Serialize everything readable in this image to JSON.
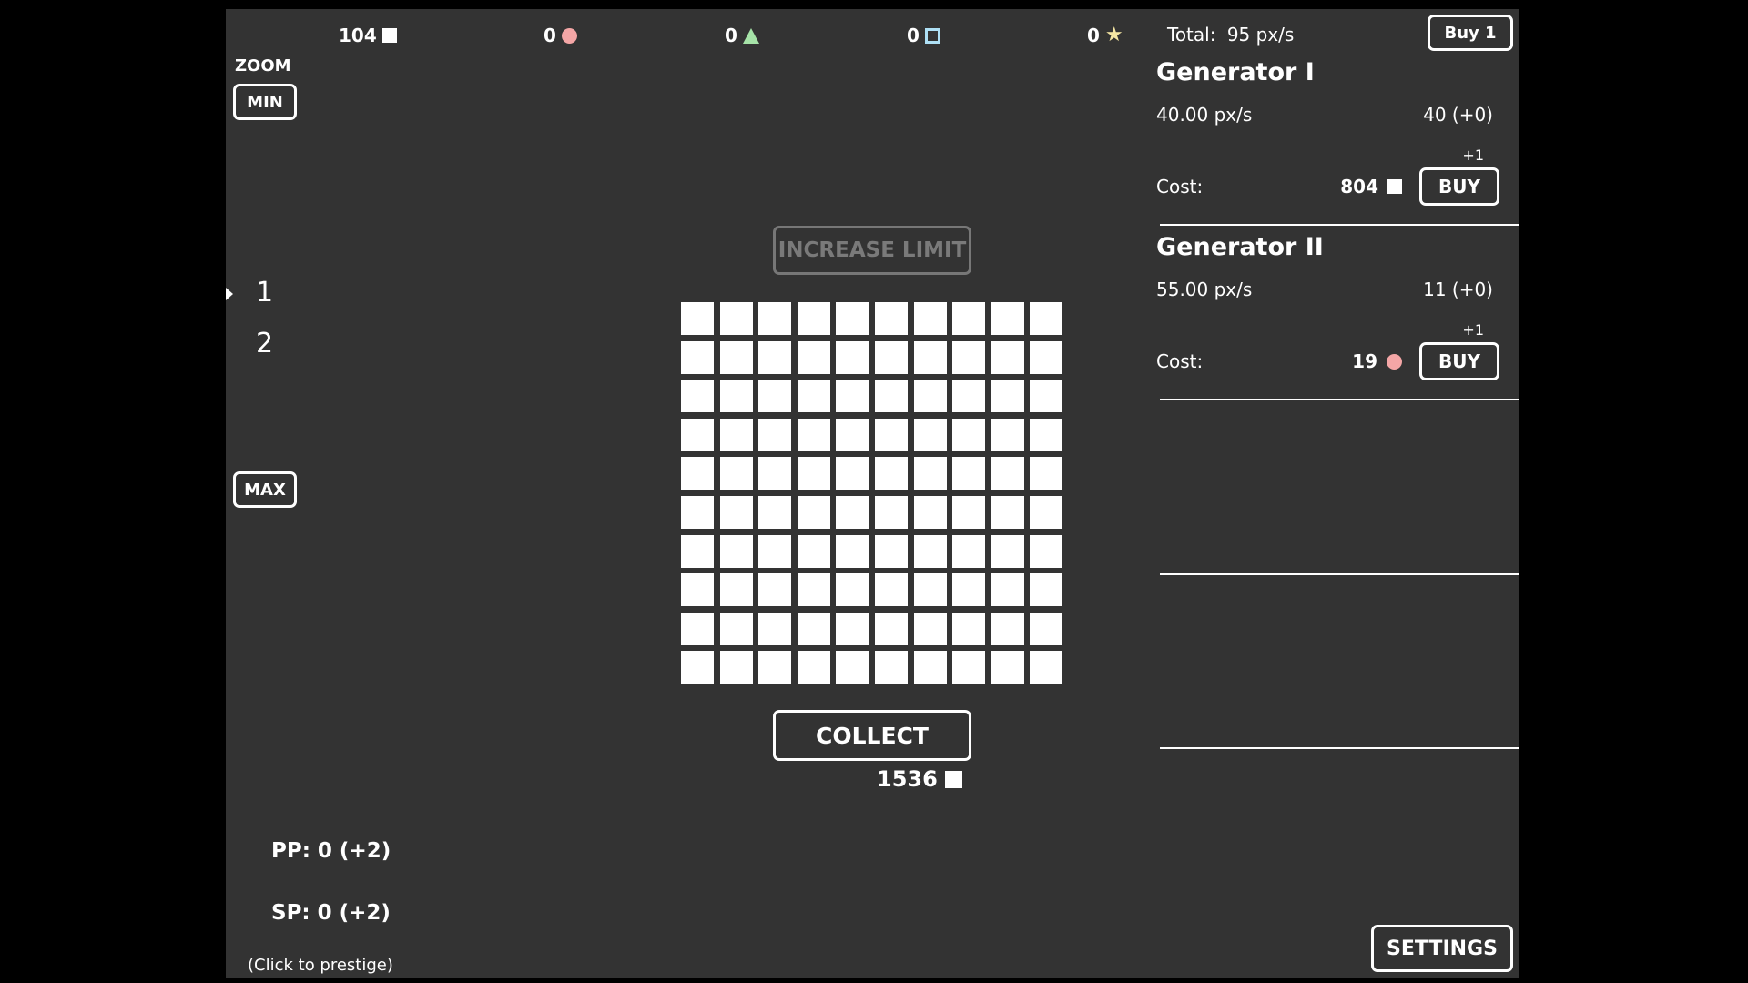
{
  "resources": [
    {
      "value": "104",
      "icon": "white-square-icon",
      "color": "#ffffff"
    },
    {
      "value": "0",
      "icon": "pink-circle-icon",
      "color": "#f4a6a6"
    },
    {
      "value": "0",
      "icon": "green-triangle-icon",
      "color": "#a6e3a8"
    },
    {
      "value": "0",
      "icon": "blue-outline-square-icon",
      "color": "#aee0f5"
    },
    {
      "value": "0",
      "icon": "yellow-star-icon",
      "color": "#f5e6a3"
    }
  ],
  "total": {
    "label": "Total:",
    "value": "95 px/s"
  },
  "buy_mode_label": "Buy 1",
  "zoom": {
    "label": "ZOOM",
    "min_label": "MIN",
    "max_label": "MAX",
    "layers": [
      "1",
      "2"
    ],
    "selected_layer": "1"
  },
  "increase_limit_label": "INCREASE LIMIT",
  "grid": {
    "rows": 10,
    "cols": 10,
    "cell_color": "#ffffff"
  },
  "collect": {
    "label": "COLLECT",
    "amount": "1536"
  },
  "generators": [
    {
      "title": "Generator I",
      "rate": "40.00 px/s",
      "count": "40 (+0)",
      "increment": "+1",
      "cost_label": "Cost:",
      "cost": "804",
      "cost_icon": "white-square-icon",
      "buy_label": "BUY"
    },
    {
      "title": "Generator II",
      "rate": "55.00 px/s",
      "count": "11 (+0)",
      "increment": "+1",
      "cost_label": "Cost:",
      "cost": "19",
      "cost_icon": "pink-circle-icon",
      "buy_label": "BUY"
    }
  ],
  "prestige": {
    "pp": "PP: 0 (+2)",
    "sp": "SP: 0 (+2)",
    "hint": "(Click to prestige)"
  },
  "settings_label": "SETTINGS",
  "colors": {
    "background": "#333333",
    "outer": "#000000",
    "pink": "#f4a6a6",
    "green": "#a6e3a8",
    "blue": "#aee0f5",
    "yellow": "#f5e6a3"
  }
}
